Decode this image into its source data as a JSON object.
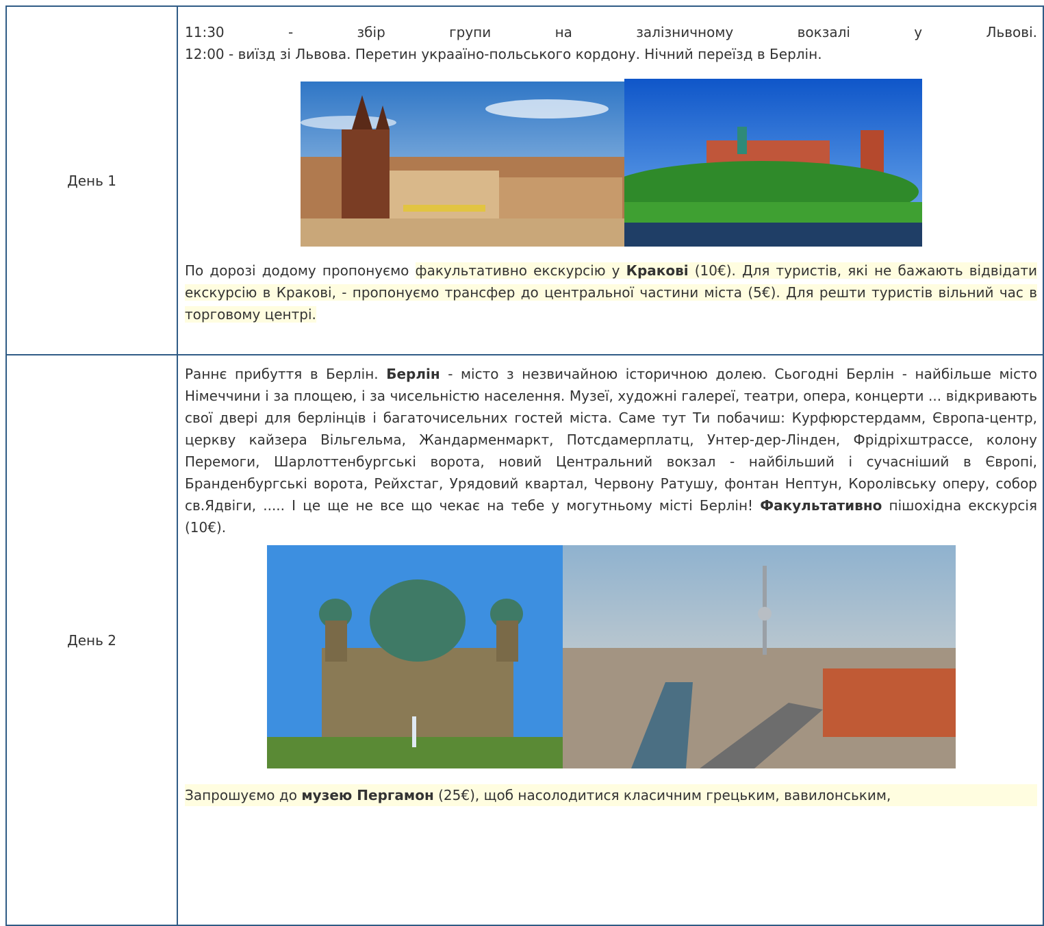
{
  "days": [
    {
      "label": "День 1",
      "intro_line1": "11:30 - збір групи на залізничному вокзалі у Львові.",
      "intro_line2": "12:00 - виїзд зі Львова. Перетин украаїно-польського кордону. Нічний переїзд в Берлін.",
      "images": [
        "krakow-market-square-photo",
        "wawel-castle-photo"
      ],
      "p2_part1": "По дорозі додому пропонуємо ",
      "p2_part2": "факультативно екскурсію у ",
      "p2_bold": "Кракові",
      "p2_part3": " (10€). Для туристів, які не бажають відвідати екскурсію в Кракові, - пропонуємо трансфер до центральної частини міста (5€). Для решти туристів вільний час в торговому центрі."
    },
    {
      "label": "День 2",
      "p1_part1": "Раннє прибуття в Берлін. ",
      "p1_bold1": "Берлін",
      "p1_part2": " - місто з незвичайною історичною долею. Сьогодні Берлін - найбільше місто Німеччини і за площею, і за чисельністю населення. Музеї, художні галереї, театри, опера, концерти ... відкривають свої двері для берлінців і багаточисельних гостей міста. Саме тут Ти побачиш: Курфюрстердамм, Європа-центр, церкву кайзера Вільгельма, Жандарменмаркт, Потсдамерплатц, Унтер-дер-Лінден, Фрідріхштрассе, колону Перемоги, Шарлоттенбургські ворота,  новий Центральний вокзал - найбільший і сучасніший в Європі, Бранденбургські ворота, Рейхстаг, Урядовий квартал, Червону Ратушу, фонтан Нептун, Королівську оперу, собор св.Ядвіги, ..... І це ще не все що чекає на тебе у могутньому місті Берлін! ",
      "p1_bold2": "Факультативно",
      "p1_part3": " пішохідна екскурсія (10€).",
      "images": [
        "berlin-cathedral-photo",
        "berlin-skyline-photo"
      ],
      "p2_part1": "Запрошуємо до ",
      "p2_bold": "музею Пергамон",
      "p2_part2": " (25€), щоб насолодитися класичним грецьким, вавилонським,"
    }
  ]
}
